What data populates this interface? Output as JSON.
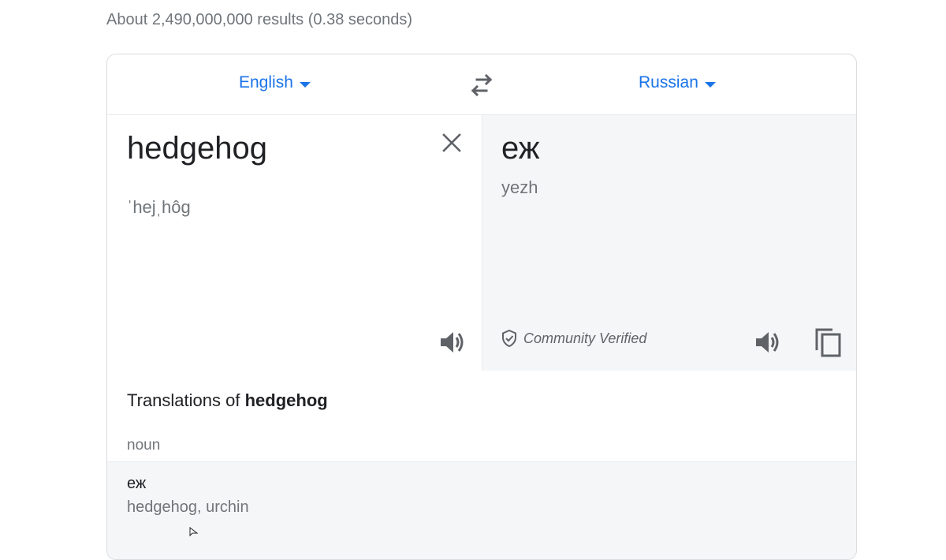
{
  "results": {
    "count_text": "About 2,490,000,000 results (0.38 seconds)"
  },
  "translator": {
    "source_language": "English",
    "target_language": "Russian",
    "source": {
      "text": "hedgehog",
      "pronunciation": "ˈhejˌhôg"
    },
    "target": {
      "text": "еж",
      "transliteration": "yezh",
      "verified_label": "Community Verified"
    }
  },
  "translations": {
    "title_prefix": "Translations of ",
    "title_word": "hedgehog",
    "part_of_speech": "noun",
    "rows": [
      {
        "word": "еж",
        "synonyms": "hedgehog, urchin"
      }
    ]
  },
  "colors": {
    "accent": "#1a73e8",
    "muted": "#70757a",
    "text": "#202124",
    "pane_gray": "#f5f6f7"
  },
  "icons": [
    "chevron-down-icon",
    "swap-icon",
    "close-icon",
    "speaker-icon",
    "shield-check-icon",
    "copy-icon",
    "mouse-cursor-icon"
  ]
}
